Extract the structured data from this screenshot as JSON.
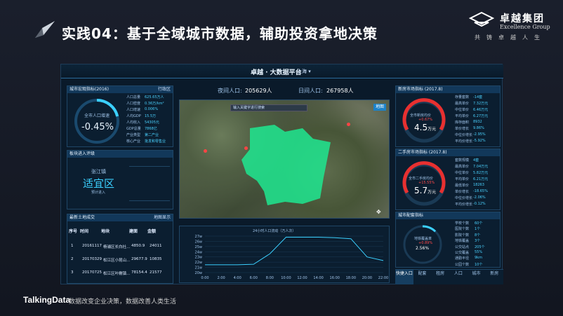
{
  "slide": {
    "title": "实践04：基于全域城市数据，辅助投资拿地决策",
    "brand_cn": "卓越集团",
    "brand_en": "Excellence Group",
    "brand_sub": "共铸卓越人生",
    "footer_brand": "TalkingData",
    "footer_slogan": "数据改变企业决策，数据改善人类生活"
  },
  "dashboard": {
    "title": "卓越 · 大数据平台",
    "city": "上海 ▾",
    "night_label": "夜间人口:",
    "night_value": "205629人",
    "day_label": "日间人口:",
    "day_value": "267958人",
    "pop_panel": {
      "title": "城市宏观指标(2016)",
      "tag": "行政区",
      "center_label": "全市人口增速",
      "center_value": "-0.45%",
      "rows": [
        {
          "k": "人口总量",
          "v": "625.65万人"
        },
        {
          "k": "人口密度",
          "v": "0.36万/km²"
        },
        {
          "k": "人口增速",
          "v": "0.006%"
        },
        {
          "k": "人均GDP",
          "v": "15.5万"
        },
        {
          "k": "人均收入",
          "v": "54305元"
        },
        {
          "k": "GDP总量",
          "v": "7868亿"
        },
        {
          "k": "产业类型",
          "v": "第二产业"
        },
        {
          "k": "核心产业",
          "v": "批发和零售业"
        }
      ]
    },
    "eval_panel": {
      "title": "板块进入评级",
      "area": "张江镇",
      "rating": "适宜区",
      "note": "预计进入"
    },
    "land_panel": {
      "title": "最新土地成交",
      "tag": "地图显示",
      "headers": [
        "序号",
        "时间",
        "地块",
        "建面",
        "金额"
      ],
      "rows": [
        [
          "1",
          "20161117",
          "杨浦区长白社...",
          "4850.9",
          "24011"
        ],
        [
          "2",
          "20170329",
          "松江区小昆山...",
          "29677.9",
          "10835"
        ],
        [
          "3",
          "20170725",
          "松江区叶榭镇...",
          "78154.4",
          "21577"
        ]
      ]
    },
    "map": {
      "search_placeholder": "输入关键字进行搜索",
      "btn": "地图"
    },
    "flow_chart": {
      "title": "24小时人口流动（万人次）"
    },
    "new_house": {
      "title": "新房市场指标 (2017.8)",
      "gauge_label": "全市新房均价",
      "gauge_change": "+0.67%",
      "gauge_value": "4.5",
      "gauge_unit": "万元",
      "rows": [
        {
          "k": "存量套数",
          "v": "-14套"
        },
        {
          "k": "最高单价",
          "v": "7.32万元"
        },
        {
          "k": "中位单价",
          "v": "6.46万元"
        },
        {
          "k": "平均单价",
          "v": "6.27万元"
        },
        {
          "k": "库存面积",
          "v": "8932"
        },
        {
          "k": "单价增长",
          "v": "9.86%"
        },
        {
          "k": "中位价增长",
          "v": "-2.95%"
        },
        {
          "k": "平均价增长",
          "v": "-5.92%"
        }
      ]
    },
    "second_house": {
      "title": "二手房市场指标 (2017.8)",
      "gauge_label": "全市二手房均价",
      "gauge_change": "+15.55%",
      "gauge_value": "5.7",
      "gauge_unit": "万元",
      "rows": [
        {
          "k": "套数规模",
          "v": "4套"
        },
        {
          "k": "最高单价",
          "v": "7.04万元"
        },
        {
          "k": "中位单价",
          "v": "5.82万元"
        },
        {
          "k": "平均单价",
          "v": "6.21万元"
        },
        {
          "k": "最低单价",
          "v": "18263"
        },
        {
          "k": "单价增长",
          "v": "-18.65%"
        },
        {
          "k": "中位价增长",
          "v": "-2.06%"
        },
        {
          "k": "平均价增长",
          "v": "-0.12%"
        }
      ]
    },
    "facility": {
      "title": "城市配套指标",
      "gauge_label": "地铁覆盖率",
      "gauge_change": "+0.89%",
      "gauge_value": "2.56%",
      "rows": [
        {
          "k": "学校个数",
          "v": "60个"
        },
        {
          "k": "医院个数",
          "v": "1个"
        },
        {
          "k": "影院个数",
          "v": "8个"
        },
        {
          "k": "地铁覆盖",
          "v": "3个"
        },
        {
          "k": "公交站点",
          "v": "205个"
        },
        {
          "k": "公交覆盖",
          "v": "55%"
        },
        {
          "k": "通勤半径",
          "v": "9km"
        },
        {
          "k": "公园个数",
          "v": "10个"
        }
      ]
    },
    "tabs": [
      "快捷入口",
      "配套",
      "租房",
      "人口",
      "城市",
      "新房"
    ]
  },
  "chart_data": {
    "type": "line",
    "title": "24小时人口流动（万人次）",
    "x": [
      "0:00",
      "2:00",
      "4:00",
      "6:00",
      "8:00",
      "10:00",
      "12:00",
      "14:00",
      "16:00",
      "18:00",
      "20:00",
      "22:00"
    ],
    "values": [
      21.5,
      21.5,
      21.5,
      21.6,
      23.6,
      26.8,
      26.8,
      26.8,
      26.7,
      26.5,
      23.0,
      22.3
    ],
    "ytick_labels": [
      "27w",
      "26w",
      "25w",
      "24w",
      "23w",
      "22w",
      "21w",
      "20w"
    ],
    "ylim": [
      20,
      27
    ]
  }
}
